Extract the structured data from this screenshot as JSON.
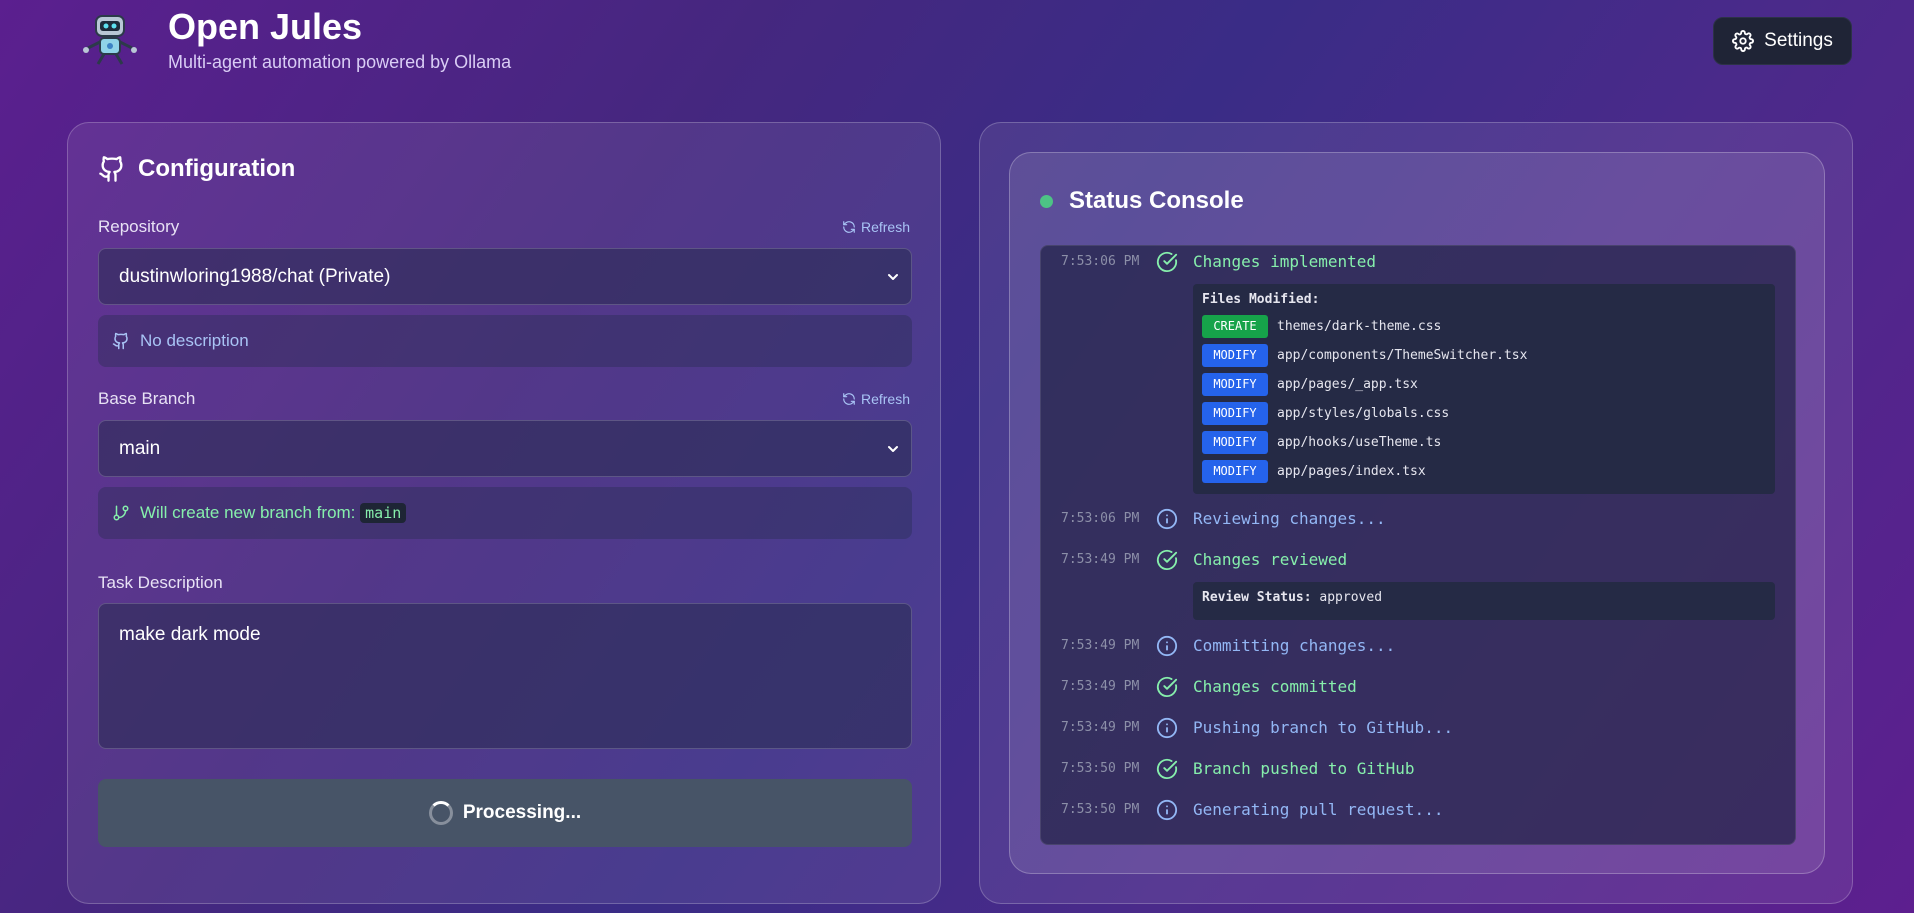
{
  "header": {
    "title": "Open Jules",
    "subtitle": "Multi-agent automation powered by Ollama",
    "settings_label": "Settings"
  },
  "config": {
    "title": "Configuration",
    "repository": {
      "label": "Repository",
      "refresh_label": "Refresh",
      "value": "dustinwloring1988/chat (Private)",
      "description": "No description"
    },
    "branch": {
      "label": "Base Branch",
      "refresh_label": "Refresh",
      "value": "main",
      "info_prefix": "Will create new branch from:",
      "info_branch": "main"
    },
    "task": {
      "label": "Task Description",
      "value": "make dark mode"
    },
    "submit_label": "Processing..."
  },
  "status": {
    "title": "Status Console",
    "logs": [
      {
        "time": "7:53:06 PM",
        "type": "success",
        "message": "Changes implemented"
      },
      {
        "time": "7:53:06 PM",
        "type": "info",
        "message": "Reviewing changes..."
      },
      {
        "time": "7:53:49 PM",
        "type": "success",
        "message": "Changes reviewed"
      },
      {
        "time": "7:53:49 PM",
        "type": "info",
        "message": "Committing changes..."
      },
      {
        "time": "7:53:49 PM",
        "type": "success",
        "message": "Changes committed"
      },
      {
        "time": "7:53:49 PM",
        "type": "info",
        "message": "Pushing branch to GitHub..."
      },
      {
        "time": "7:53:50 PM",
        "type": "success",
        "message": "Branch pushed to GitHub"
      },
      {
        "time": "7:53:50 PM",
        "type": "info",
        "message": "Generating pull request..."
      }
    ],
    "files_modified": {
      "heading": "Files Modified:",
      "files": [
        {
          "action": "CREATE",
          "path": "themes/dark-theme.css"
        },
        {
          "action": "MODIFY",
          "path": "app/components/ThemeSwitcher.tsx"
        },
        {
          "action": "MODIFY",
          "path": "app/pages/_app.tsx"
        },
        {
          "action": "MODIFY",
          "path": "app/styles/globals.css"
        },
        {
          "action": "MODIFY",
          "path": "app/hooks/useTheme.ts"
        },
        {
          "action": "MODIFY",
          "path": "app/pages/index.tsx"
        }
      ]
    },
    "review": {
      "label": "Review Status:",
      "value": "approved"
    }
  }
}
